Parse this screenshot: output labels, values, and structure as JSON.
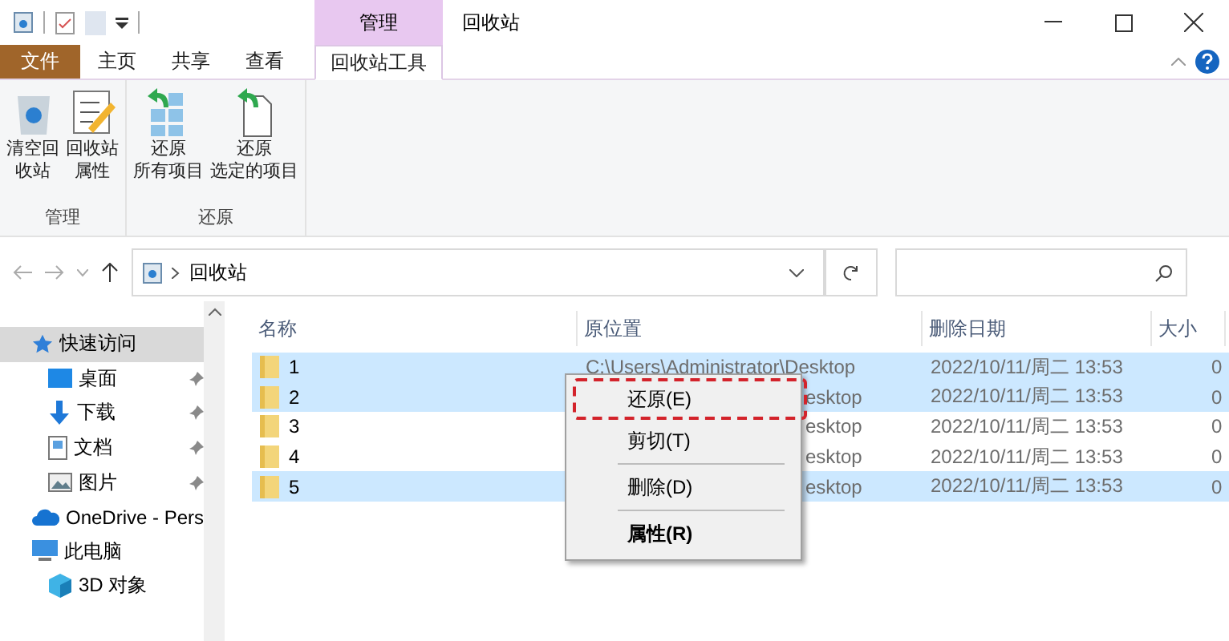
{
  "window": {
    "title": "回收站",
    "context_tab": "管理"
  },
  "ribbon_tabs": [
    {
      "label": "文件",
      "kind": "file",
      "selected": false
    },
    {
      "label": "主页",
      "kind": "tab",
      "selected": false
    },
    {
      "label": "共享",
      "kind": "tab",
      "selected": false
    },
    {
      "label": "查看",
      "kind": "tab",
      "selected": false
    },
    {
      "label": "回收站工具",
      "kind": "tab",
      "selected": true
    }
  ],
  "ribbon_groups": [
    {
      "label": "管理",
      "buttons": [
        {
          "lines": [
            "清空回",
            "收站"
          ]
        },
        {
          "lines": [
            "回收站",
            "属性"
          ]
        }
      ]
    },
    {
      "label": "还原",
      "buttons": [
        {
          "lines": [
            "还原",
            "所有项目"
          ]
        },
        {
          "lines": [
            "还原",
            "选定的项目"
          ]
        }
      ]
    }
  ],
  "address_bar": {
    "path": [
      "回收站"
    ]
  },
  "sidebar": {
    "items": [
      {
        "label": "快速访问",
        "selected": true,
        "pinned": false,
        "children": [
          {
            "label": "桌面",
            "selected": false,
            "pinned": true
          },
          {
            "label": "下载",
            "selected": false,
            "pinned": true
          },
          {
            "label": "文档",
            "selected": false,
            "pinned": true
          },
          {
            "label": "图片",
            "selected": false,
            "pinned": true
          }
        ]
      },
      {
        "label": "OneDrive - Pers",
        "selected": false,
        "pinned": false
      },
      {
        "label": "此电脑",
        "selected": false,
        "pinned": false,
        "children": [
          {
            "label": "3D 对象",
            "selected": false,
            "pinned": false
          }
        ]
      }
    ]
  },
  "table": {
    "columns": [
      "名称",
      "原位置",
      "删除日期",
      "大小"
    ],
    "rows": [
      {
        "name": "1",
        "location": "C:\\Users\\Administrator\\Desktop",
        "date": "2022/10/11/周二 13:53",
        "size": "0",
        "selected": true,
        "covered": false
      },
      {
        "name": "2",
        "location": "esktop",
        "date": "2022/10/11/周二 13:53",
        "size": "0",
        "selected": true,
        "covered": true
      },
      {
        "name": "3",
        "location": "esktop",
        "date": "2022/10/11/周二 13:53",
        "size": "0",
        "selected": false,
        "covered": true
      },
      {
        "name": "4",
        "location": "esktop",
        "date": "2022/10/11/周二 13:53",
        "size": "0",
        "selected": false,
        "covered": true
      },
      {
        "name": "5",
        "location": "esktop",
        "date": "2022/10/11/周二 13:53",
        "size": "0",
        "selected": true,
        "covered": true
      }
    ]
  },
  "context_menu": {
    "items": [
      {
        "kind": "command",
        "label": "还原(E)",
        "annotated": true,
        "bold": false
      },
      {
        "kind": "command",
        "label": "剪切(T)",
        "annotated": false,
        "bold": false
      },
      {
        "kind": "separator"
      },
      {
        "kind": "command",
        "label": "删除(D)",
        "annotated": false,
        "bold": false
      },
      {
        "kind": "separator"
      },
      {
        "kind": "command",
        "label": "属性(R)",
        "annotated": false,
        "bold": true
      }
    ]
  }
}
